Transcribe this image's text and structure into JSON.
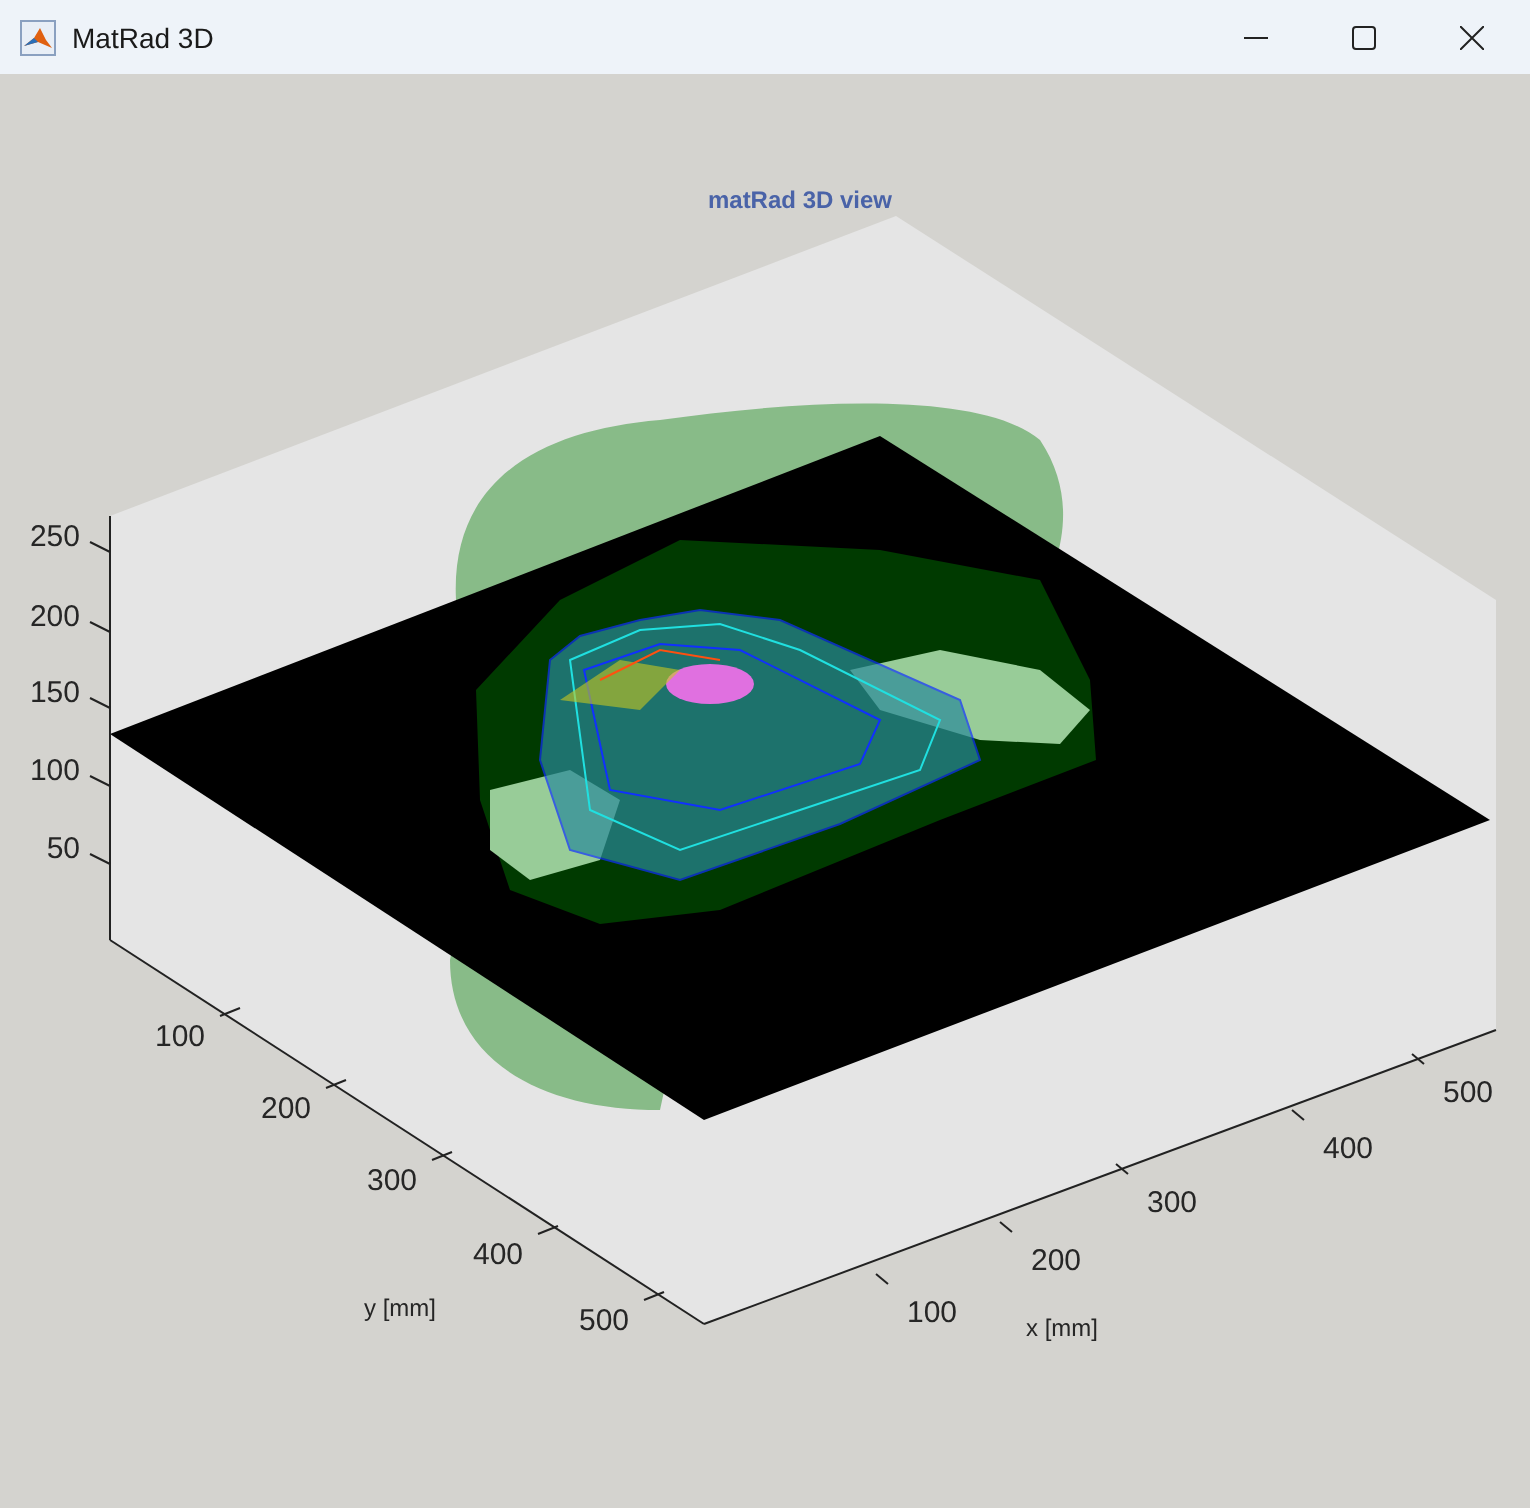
{
  "window": {
    "title": "MatRad 3D"
  },
  "plot": {
    "title": "matRad 3D view",
    "z_ticks": [
      "250",
      "200",
      "150",
      "100",
      "50"
    ],
    "y_ticks": [
      "100",
      "200",
      "300",
      "400",
      "500"
    ],
    "x_ticks": [
      "100",
      "200",
      "300",
      "400",
      "500"
    ],
    "ylabel": "y [mm]",
    "xlabel": "x [mm]"
  }
}
